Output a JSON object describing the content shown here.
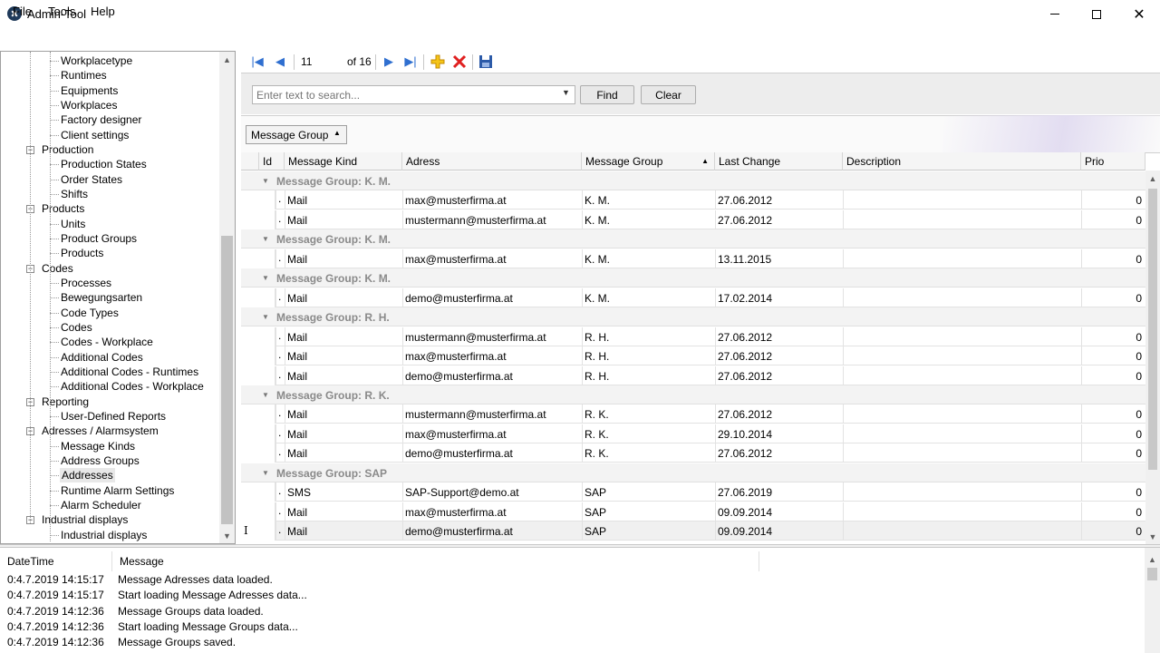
{
  "window": {
    "title": "Admin-Tool",
    "minimize": "—",
    "maximize": "☐",
    "close": "✕"
  },
  "menu": {
    "file": "File",
    "tools": "Tools",
    "help": "Help"
  },
  "tree": {
    "items": [
      {
        "label": "Workplacetype",
        "level": 2
      },
      {
        "label": "Runtimes",
        "level": 2
      },
      {
        "label": "Equipments",
        "level": 2
      },
      {
        "label": "Workplaces",
        "level": 2
      },
      {
        "label": "Factory designer",
        "level": 2
      },
      {
        "label": "Client settings",
        "level": 2
      },
      {
        "label": "Production",
        "level": 1,
        "expanded": true
      },
      {
        "label": "Production States",
        "level": 2
      },
      {
        "label": "Order States",
        "level": 2
      },
      {
        "label": "Shifts",
        "level": 2
      },
      {
        "label": "Products",
        "level": 1,
        "expanded": true
      },
      {
        "label": "Units",
        "level": 2
      },
      {
        "label": "Product Groups",
        "level": 2
      },
      {
        "label": "Products",
        "level": 2
      },
      {
        "label": "Codes",
        "level": 1,
        "expanded": true
      },
      {
        "label": "Processes",
        "level": 2
      },
      {
        "label": "Bewegungsarten",
        "level": 2
      },
      {
        "label": "Code Types",
        "level": 2
      },
      {
        "label": "Codes",
        "level": 2
      },
      {
        "label": "Codes - Workplace",
        "level": 2
      },
      {
        "label": "Additional Codes",
        "level": 2
      },
      {
        "label": "Additional Codes - Runtimes",
        "level": 2
      },
      {
        "label": "Additional Codes - Workplace",
        "level": 2
      },
      {
        "label": "Reporting",
        "level": 1,
        "expanded": true
      },
      {
        "label": "User-Defined Reports",
        "level": 2
      },
      {
        "label": "Adresses / Alarmsystem",
        "level": 1,
        "expanded": true
      },
      {
        "label": "Message Kinds",
        "level": 2
      },
      {
        "label": "Address Groups",
        "level": 2
      },
      {
        "label": "Addresses",
        "level": 2,
        "selected": true
      },
      {
        "label": "Runtime Alarm Settings",
        "level": 2
      },
      {
        "label": "Alarm Scheduler",
        "level": 2
      },
      {
        "label": "Industrial displays",
        "level": 1,
        "expanded": true
      },
      {
        "label": "Industrial displays",
        "level": 2
      }
    ]
  },
  "navigator": {
    "current_page": "11",
    "of_label": "of 16"
  },
  "search": {
    "placeholder": "Enter text to search...",
    "find": "Find",
    "clear": "Clear"
  },
  "group_panel": {
    "chip_label": "Message Group"
  },
  "grid": {
    "columns": [
      "Id",
      "Message Kind",
      "Adress",
      "Message Group",
      "Last Change",
      "Description",
      "Prio"
    ],
    "sort_column": "Message Group",
    "groups": [
      {
        "label": "Message Group: K. M.",
        "rows": [
          {
            "kind": "Mail",
            "adress": "max@musterfirma.at",
            "group": "K. M.",
            "last_change": "27.06.2012",
            "desc": "",
            "prio": "0"
          },
          {
            "kind": "Mail",
            "adress": "mustermann@musterfirma.at",
            "group": "K. M.",
            "last_change": "27.06.2012",
            "desc": "",
            "prio": "0"
          }
        ]
      },
      {
        "label": "Message Group: K. M.",
        "rows": [
          {
            "kind": "Mail",
            "adress": "max@musterfirma.at",
            "group": "K. M.",
            "last_change": "13.11.2015",
            "desc": "",
            "prio": "0"
          }
        ]
      },
      {
        "label": "Message Group: K. M.",
        "rows": [
          {
            "kind": "Mail",
            "adress": "demo@musterfirma.at",
            "group": "K. M.",
            "last_change": "17.02.2014",
            "desc": "",
            "prio": "0"
          }
        ]
      },
      {
        "label": "Message Group: R. H.",
        "rows": [
          {
            "kind": "Mail",
            "adress": "mustermann@musterfirma.at",
            "group": "R. H.",
            "last_change": "27.06.2012",
            "desc": "",
            "prio": "0"
          },
          {
            "kind": "Mail",
            "adress": "max@musterfirma.at",
            "group": "R. H.",
            "last_change": "27.06.2012",
            "desc": "",
            "prio": "0"
          },
          {
            "kind": "Mail",
            "adress": "demo@musterfirma.at",
            "group": "R. H.",
            "last_change": "27.06.2012",
            "desc": "",
            "prio": "0"
          }
        ]
      },
      {
        "label": "Message Group: R. K.",
        "rows": [
          {
            "kind": "Mail",
            "adress": "mustermann@musterfirma.at",
            "group": "R. K.",
            "last_change": "27.06.2012",
            "desc": "",
            "prio": "0"
          },
          {
            "kind": "Mail",
            "adress": "max@musterfirma.at",
            "group": "R. K.",
            "last_change": "29.10.2014",
            "desc": "",
            "prio": "0"
          },
          {
            "kind": "Mail",
            "adress": "demo@musterfirma.at",
            "group": "R. K.",
            "last_change": "27.06.2012",
            "desc": "",
            "prio": "0"
          }
        ]
      },
      {
        "label": "Message Group: SAP",
        "rows": [
          {
            "kind": "SMS",
            "adress": "SAP-Support@demo.at",
            "group": "SAP",
            "last_change": "27.06.2019",
            "desc": "",
            "prio": "0"
          },
          {
            "kind": "Mail",
            "adress": "max@musterfirma.at",
            "group": "SAP",
            "last_change": "09.09.2014",
            "desc": "",
            "prio": "0"
          },
          {
            "kind": "Mail",
            "adress": "demo@musterfirma.at",
            "group": "SAP",
            "last_change": "09.09.2014",
            "desc": "",
            "prio": "0"
          }
        ]
      }
    ]
  },
  "log": {
    "columns": [
      "DateTime",
      "Message"
    ],
    "rows": [
      {
        "time": "0:4.7.2019 14:15:17",
        "msg": "Message Adresses data loaded."
      },
      {
        "time": "0:4.7.2019 14:15:17",
        "msg": "Start loading Message Adresses data..."
      },
      {
        "time": "0:4.7.2019 14:12:36",
        "msg": "Message Groups data loaded."
      },
      {
        "time": "0:4.7.2019 14:12:36",
        "msg": "Start loading Message Groups data..."
      },
      {
        "time": "0:4.7.2019 14:12:36",
        "msg": "Message Groups saved."
      }
    ]
  }
}
